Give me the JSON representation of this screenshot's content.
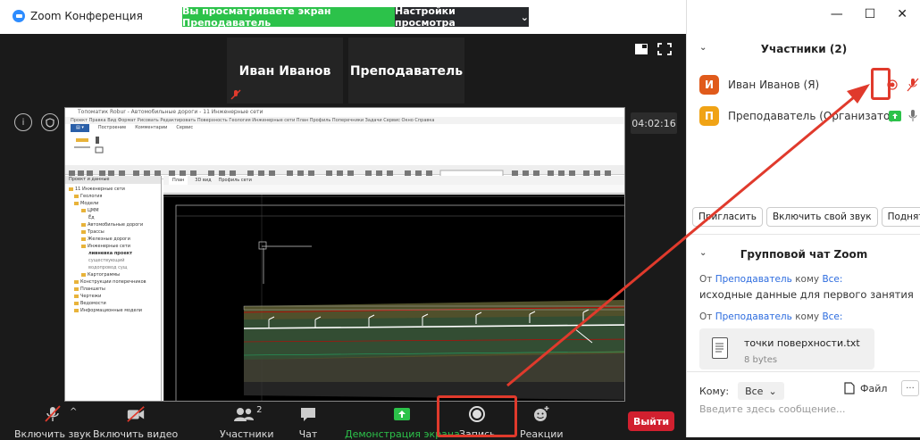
{
  "app": {
    "title": "Zoom Конференция"
  },
  "banner": {
    "viewing": "Вы просматриваете экран Преподаватель",
    "view_settings": "Настройки просмотра"
  },
  "thumbnails": [
    {
      "name": "Иван Иванов"
    },
    {
      "name": "Преподаватель"
    }
  ],
  "timer": "04:02:16",
  "shared_screen": {
    "title": "Топоматик Robur - Автомобильные дороги - 11 Инженерные сети",
    "menu": "Проект  Правка  Вид  Формат  Рисовать  Редактировать  Поверхность  Геология  Инженерные сети  План  Профиль  Поперечники  Задачи  Сервис  Окно  Справка",
    "ribbon_tabs": [
      "Построение",
      "Комментарии",
      "Сервис"
    ],
    "tree_header": "Проект и данные",
    "tree": [
      "11 Инженерные сети",
      "Геология",
      "Модели",
      "ЦММ",
      "Ёд",
      "Автомобильные дороги",
      "Трассы",
      "Железные дороги",
      "Инженерные сети",
      "ливневка проект",
      "существующий",
      "водопровод сущ",
      "Картограммы",
      "Конструкции поперечников",
      "Планшеты",
      "Чертежи",
      "Ведомости",
      "Информационные модели"
    ],
    "view_tabs": [
      "План",
      "3D вид",
      "Профиль сети"
    ]
  },
  "toolbar": {
    "mute": "Включить звук",
    "video": "Включить видео",
    "participants": "Участники",
    "participants_count": "2",
    "chat": "Чат",
    "share": "Демонстрация экрана",
    "record": "Запись",
    "reactions": "Реакции",
    "leave": "Выйти"
  },
  "participants_panel": {
    "header": "Участники (2)",
    "items": [
      {
        "initial": "И",
        "name": "Иван Иванов (Я)",
        "color": "#e05a1b"
      },
      {
        "initial": "П",
        "name": "Преподаватель (Организатор)",
        "color": "#f0a315"
      }
    ],
    "actions": [
      "Пригласить",
      "Включить свой звук",
      "Поднять руку"
    ]
  },
  "chat_panel": {
    "header": "Групповой чат Zoom",
    "messages": [
      {
        "from_prefix": "От",
        "sender": "Преподаватель",
        "to_prefix": "кому",
        "to": "Все:",
        "text": "исходные данные для первого занятия"
      },
      {
        "from_prefix": "От",
        "sender": "Преподаватель",
        "to_prefix": "кому",
        "to": "Все:"
      }
    ],
    "file": {
      "name": "точки поверхности.txt",
      "size": "8 bytes"
    },
    "to_label": "Кому:",
    "to_value": "Все",
    "file_button": "Файл",
    "more": "···",
    "input_placeholder": "Введите здесь сообщение..."
  },
  "colors": {
    "accent_red": "#e03a2c",
    "zoom_green": "#2cc24a",
    "leave_red": "#d1202f"
  }
}
